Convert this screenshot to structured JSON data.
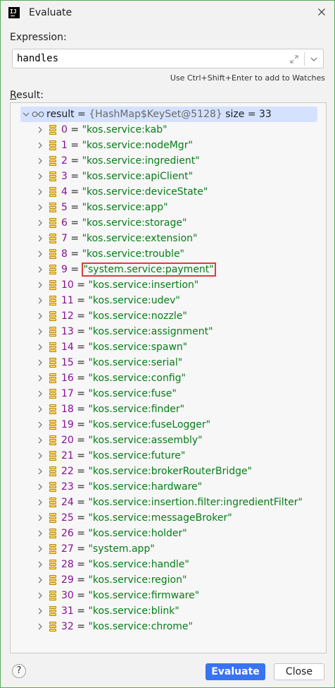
{
  "window": {
    "title": "Evaluate",
    "app_icon_text": "IJ"
  },
  "expression": {
    "label": "Expression:",
    "value": "handles",
    "hint": "Use Ctrl+Shift+Enter to add to Watches"
  },
  "result": {
    "label_underlined": "R",
    "label_rest": "esult:",
    "root": {
      "name": "result",
      "eq": " = ",
      "type": "{HashMap$KeySet@5128}",
      "size": " size = 33"
    },
    "items": [
      {
        "index": "0",
        "value": "\"kos.service:kab\""
      },
      {
        "index": "1",
        "value": "\"kos.service:nodeMgr\""
      },
      {
        "index": "2",
        "value": "\"kos.service:ingredient\""
      },
      {
        "index": "3",
        "value": "\"kos.service:apiClient\""
      },
      {
        "index": "4",
        "value": "\"kos.service:deviceState\""
      },
      {
        "index": "5",
        "value": "\"kos.service:app\""
      },
      {
        "index": "6",
        "value": "\"kos.service:storage\""
      },
      {
        "index": "7",
        "value": "\"kos.service:extension\""
      },
      {
        "index": "8",
        "value": "\"kos.service:trouble\""
      },
      {
        "index": "9",
        "value": "\"system.service:payment\"",
        "highlighted": true
      },
      {
        "index": "10",
        "value": "\"kos.service:insertion\""
      },
      {
        "index": "11",
        "value": "\"kos.service:udev\""
      },
      {
        "index": "12",
        "value": "\"kos.service:nozzle\""
      },
      {
        "index": "13",
        "value": "\"kos.service:assignment\""
      },
      {
        "index": "14",
        "value": "\"kos.service:spawn\""
      },
      {
        "index": "15",
        "value": "\"kos.service:serial\""
      },
      {
        "index": "16",
        "value": "\"kos.service:config\""
      },
      {
        "index": "17",
        "value": "\"kos.service:fuse\""
      },
      {
        "index": "18",
        "value": "\"kos.service:finder\""
      },
      {
        "index": "19",
        "value": "\"kos.service:fuseLogger\""
      },
      {
        "index": "20",
        "value": "\"kos.service:assembly\""
      },
      {
        "index": "21",
        "value": "\"kos.service:future\""
      },
      {
        "index": "22",
        "value": "\"kos.service:brokerRouterBridge\""
      },
      {
        "index": "23",
        "value": "\"kos.service:hardware\""
      },
      {
        "index": "24",
        "value": "\"kos.service:insertion.filter:ingredientFilter\""
      },
      {
        "index": "25",
        "value": "\"kos.service:messageBroker\""
      },
      {
        "index": "26",
        "value": "\"kos.service:holder\""
      },
      {
        "index": "27",
        "value": "\"system.app\""
      },
      {
        "index": "28",
        "value": "\"kos.service:handle\""
      },
      {
        "index": "29",
        "value": "\"kos.service:region\""
      },
      {
        "index": "30",
        "value": "\"kos.service:firmware\""
      },
      {
        "index": "31",
        "value": "\"kos.service:blink\""
      },
      {
        "index": "32",
        "value": "\"kos.service:chrome\""
      }
    ]
  },
  "buttons": {
    "help": "?",
    "evaluate": "Evaluate",
    "close": "Close"
  },
  "colors": {
    "accent": "#3874f0",
    "selection": "#d4e2ff",
    "string": "#067d17",
    "index": "#871094",
    "highlight_border": "#e03c3c"
  }
}
